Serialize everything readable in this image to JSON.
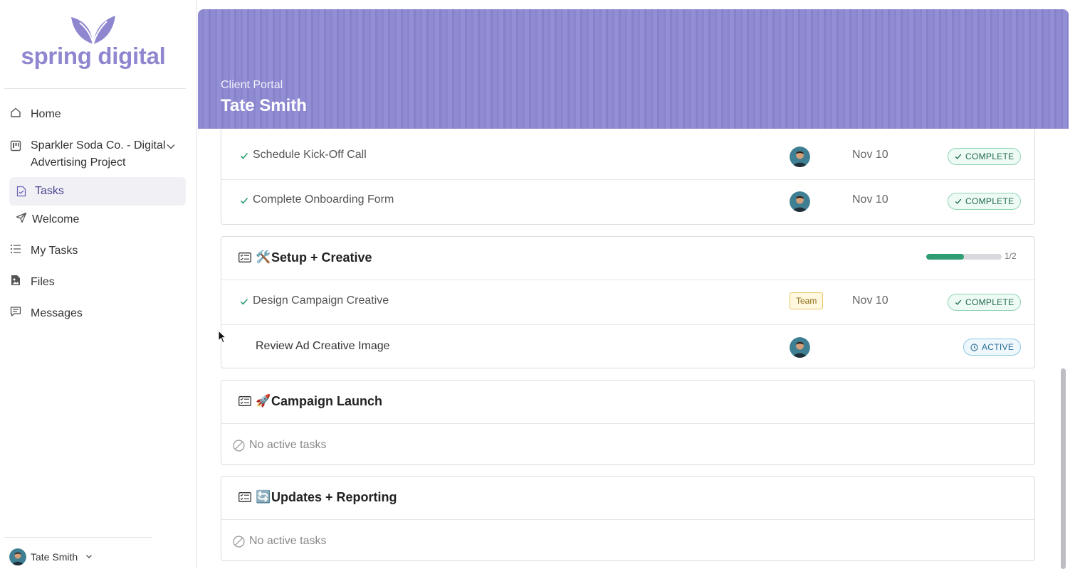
{
  "brand": {
    "name": "spring digital",
    "color": "#8e87cf"
  },
  "sidebar": {
    "items": [
      {
        "label": "Home",
        "icon": "home-icon"
      },
      {
        "label": "Sparkler Soda Co. - Digital Advertising Project",
        "label_line1": "Sparkler Soda Co. - Digital",
        "label_line2": "Advertising Project",
        "icon": "project-icon"
      },
      {
        "label": "Tasks",
        "icon": "tasks-icon",
        "active": true
      },
      {
        "label": "Welcome",
        "icon": "send-icon"
      },
      {
        "label": "My Tasks",
        "icon": "list-icon"
      },
      {
        "label": "Files",
        "icon": "file-image-icon"
      },
      {
        "label": "Messages",
        "icon": "messages-icon"
      }
    ],
    "user": {
      "name": "Tate Smith"
    }
  },
  "banner": {
    "subtitle": "Client Portal",
    "title": "Tate Smith"
  },
  "sections": {
    "kickoff": {
      "tasks": [
        {
          "name": "Schedule Kick-Off Call",
          "date": "Nov 10",
          "status": "COMPLETE"
        },
        {
          "name": "Complete Onboarding Form",
          "date": "Nov 10",
          "status": "COMPLETE"
        }
      ]
    },
    "setup": {
      "emoji": "🛠️",
      "title": "Setup + Creative",
      "progress": {
        "done": 1,
        "total": 2,
        "label": "1/2",
        "fraction": 0.5
      },
      "tasks": [
        {
          "name": "Design Campaign Creative",
          "assignee_tag": "Team",
          "date": "Nov 10",
          "status": "COMPLETE"
        },
        {
          "name": "Review Ad Creative Image",
          "status": "ACTIVE"
        }
      ]
    },
    "launch": {
      "emoji": "🚀",
      "title": "Campaign Launch",
      "empty": "No active tasks"
    },
    "reporting": {
      "emoji": "🔄",
      "title": "Updates + Reporting",
      "empty": "No active tasks"
    }
  },
  "colors": {
    "banner": "#8f8bd2",
    "complete": "#2e9e72",
    "active": "#2a6e94"
  }
}
